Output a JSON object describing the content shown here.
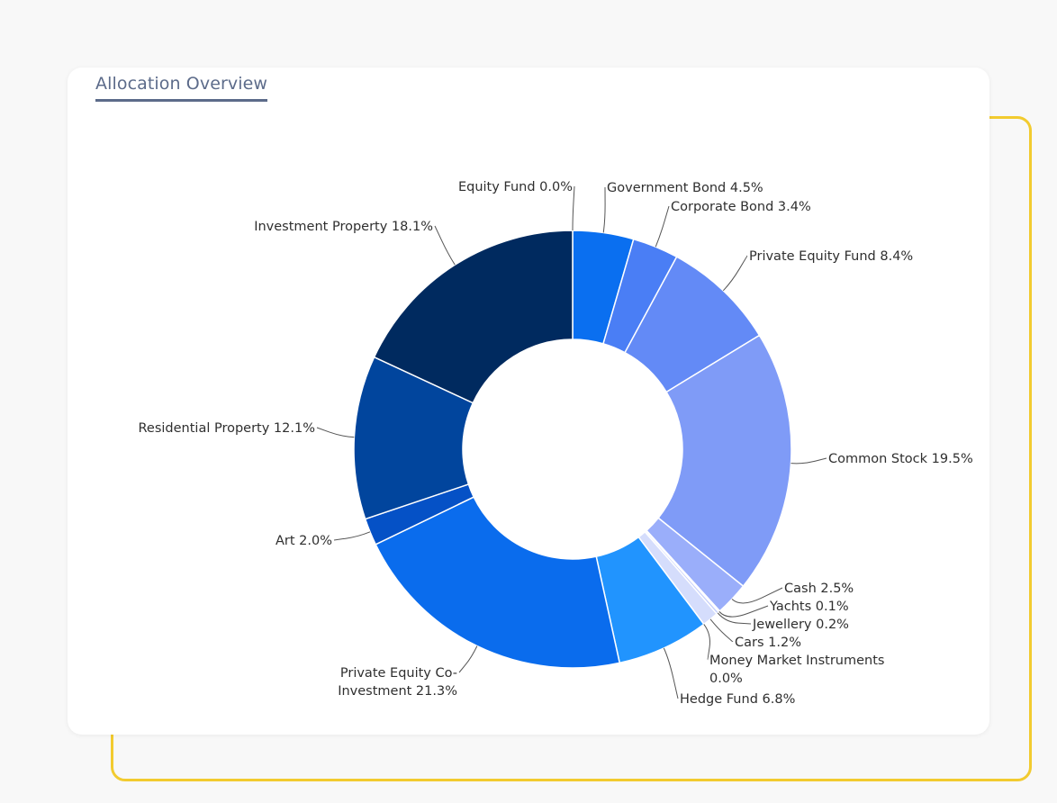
{
  "card": {
    "title": "Allocation Overview"
  },
  "chart_data": {
    "type": "pie",
    "variant": "donut",
    "title": "",
    "start": "top",
    "direction": "clockwise",
    "slices": [
      {
        "name": "Equity Fund",
        "value": 0.0,
        "label": "Equity Fund 0.0%",
        "color": "#0a6ff0"
      },
      {
        "name": "Government Bond",
        "value": 4.5,
        "label": "Government Bond 4.5%",
        "color": "#0a6ff0"
      },
      {
        "name": "Corporate Bond",
        "value": 3.4,
        "label": "Corporate Bond 3.4%",
        "color": "#4a7ef5"
      },
      {
        "name": "Private Equity Fund",
        "value": 8.4,
        "label": "Private Equity Fund 8.4%",
        "color": "#638af6"
      },
      {
        "name": "Common Stock",
        "value": 19.5,
        "label": "Common Stock 19.5%",
        "color": "#7f9bf7"
      },
      {
        "name": "Cash",
        "value": 2.5,
        "label": "Cash 2.5%",
        "color": "#9aaefa"
      },
      {
        "name": "Yachts",
        "value": 0.1,
        "label": "Yachts 0.1%",
        "color": "#b5c2fa"
      },
      {
        "name": "Jewellery",
        "value": 0.2,
        "label": "Jewellery 0.2%",
        "color": "#c5cffb"
      },
      {
        "name": "Cars",
        "value": 1.2,
        "label": "Cars 1.2%",
        "color": "#d5ddfc"
      },
      {
        "name": "Money Market Instruments",
        "value": 0.0,
        "label": "Money Market Instruments 0.0%",
        "label_lines": [
          "Money Market Instruments",
          "0.0%"
        ],
        "color": "#dfe5fd"
      },
      {
        "name": "Hedge Fund",
        "value": 6.8,
        "label": "Hedge Fund 6.8%",
        "color": "#2194fe"
      },
      {
        "name": "Private Equity Co-Investment",
        "value": 21.3,
        "label": "Private Equity Co-Investment 21.3%",
        "label_lines": [
          "Private Equity Co-",
          "Investment 21.3%"
        ],
        "color": "#0a6ced"
      },
      {
        "name": "Art",
        "value": 2.0,
        "label": "Art 2.0%",
        "color": "#0551c6"
      },
      {
        "name": "Residential Property",
        "value": 12.1,
        "label": "Residential Property 12.1%",
        "color": "#01459d"
      },
      {
        "name": "Investment Property",
        "value": 18.1,
        "label": "Investment Property 18.1%",
        "color": "#002a5f"
      }
    ]
  }
}
